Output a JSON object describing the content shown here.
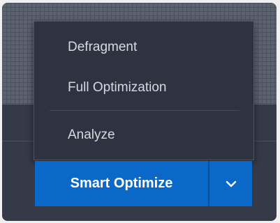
{
  "menu": {
    "items": [
      {
        "label": "Defragment"
      },
      {
        "label": "Full Optimization"
      },
      {
        "label": "Analyze"
      }
    ]
  },
  "action_button": {
    "label": "Smart Optimize",
    "toggle_icon": "chevron-down-icon"
  },
  "colors": {
    "accent": "#0a68c9",
    "panel_background": "#353a49",
    "menu_background": "#2e3342",
    "menu_text": "#d7d9df"
  }
}
